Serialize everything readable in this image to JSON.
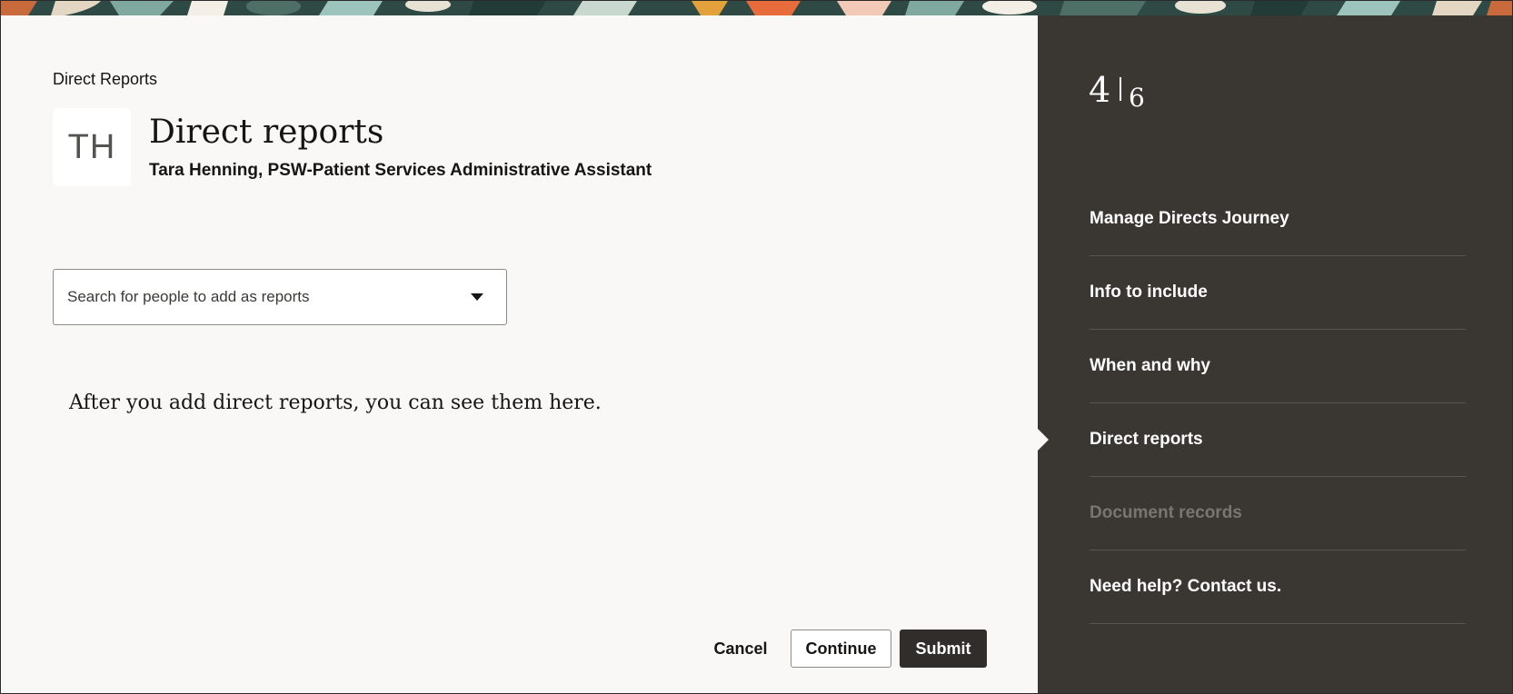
{
  "breadcrumb": "Direct Reports",
  "avatar": {
    "initials": "TH"
  },
  "page": {
    "title": "Direct reports",
    "subtitle": "Tara Henning, PSW-Patient Services Administrative Assistant"
  },
  "search": {
    "placeholder": "Search for people to add as reports",
    "icon": "chevron-down-icon"
  },
  "empty_message": "After you add direct reports, you can see them here.",
  "actions": {
    "cancel_label": "Cancel",
    "continue_label": "Continue",
    "submit_label": "Submit"
  },
  "steps": {
    "current": "4",
    "total": "6",
    "items": [
      {
        "label": "Manage Directs Journey",
        "state": "enabled"
      },
      {
        "label": "Info to include",
        "state": "enabled"
      },
      {
        "label": "When and why",
        "state": "enabled"
      },
      {
        "label": "Direct reports",
        "state": "current"
      },
      {
        "label": "Document records",
        "state": "disabled"
      },
      {
        "label": "Need help? Contact us.",
        "state": "enabled"
      }
    ]
  },
  "colors": {
    "main_bg": "#f9f8f6",
    "sidebar_bg": "#3a3632",
    "submit_bg": "#312d2a",
    "disabled_text": "#7a7570"
  }
}
